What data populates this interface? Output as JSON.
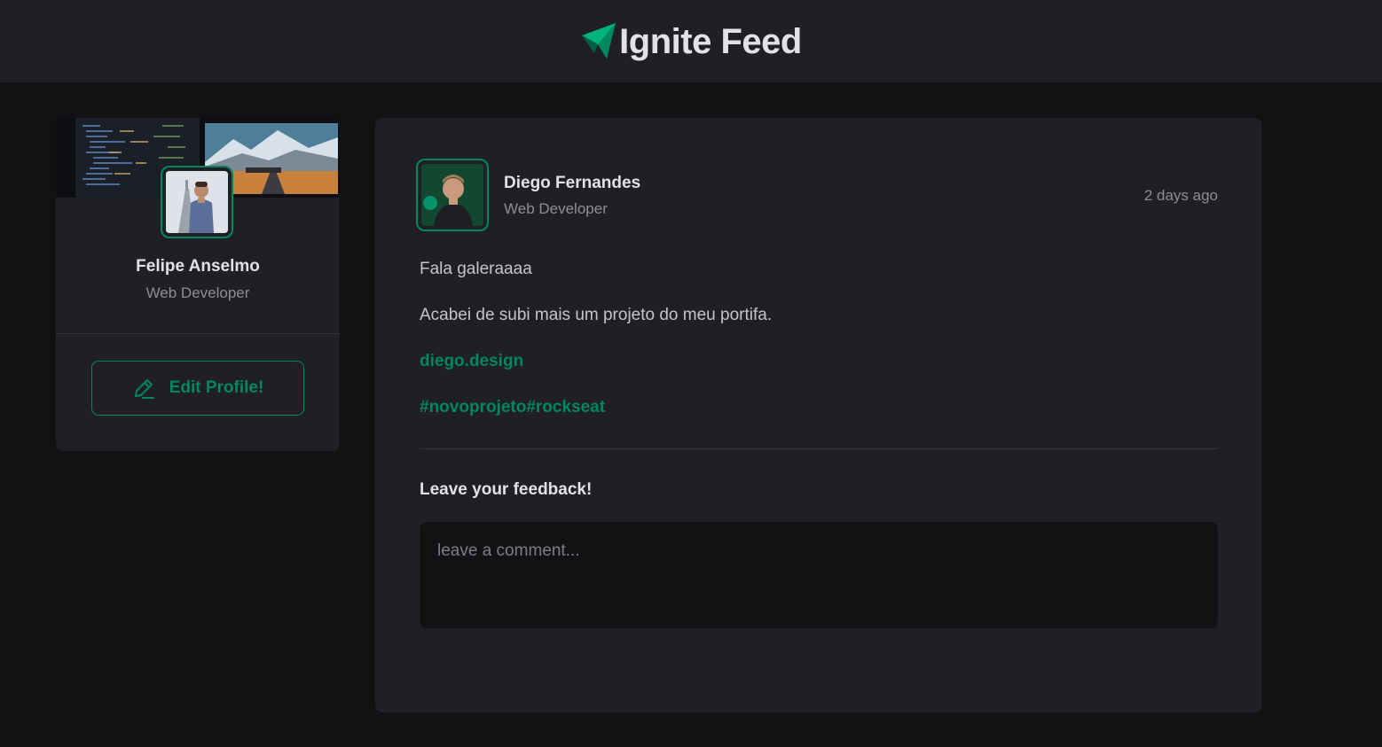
{
  "header": {
    "title": "Ignite Feed",
    "logo_icon": "paper-plane-logo-icon",
    "accent": "#00875f"
  },
  "sidebar": {
    "cover_image": "code-editor-and-landscape-cover",
    "avatar_image": "person-portrait-avatar",
    "name": "Felipe Anselmo",
    "role": "Web Developer",
    "edit_button": {
      "label": "Edit Profile!",
      "icon": "pencil-icon"
    }
  },
  "post": {
    "author": {
      "avatar_image": "person-portrait-avatar",
      "name": "Diego Fernandes",
      "role": "Web Developer"
    },
    "time": "2 days ago",
    "paragraphs": [
      "Fala galeraaaa",
      "Acabei de subi mais um projeto do meu portifa."
    ],
    "link": "diego.design",
    "hashtags": "#novoprojeto#rockseat",
    "feedback_title": "Leave your feedback!",
    "comment_placeholder": "leave a comment..."
  },
  "colors": {
    "background": "#121214",
    "surface": "#202024",
    "accent": "#00875f",
    "text": "#e1e1e6",
    "muted": "#8d8d99"
  }
}
